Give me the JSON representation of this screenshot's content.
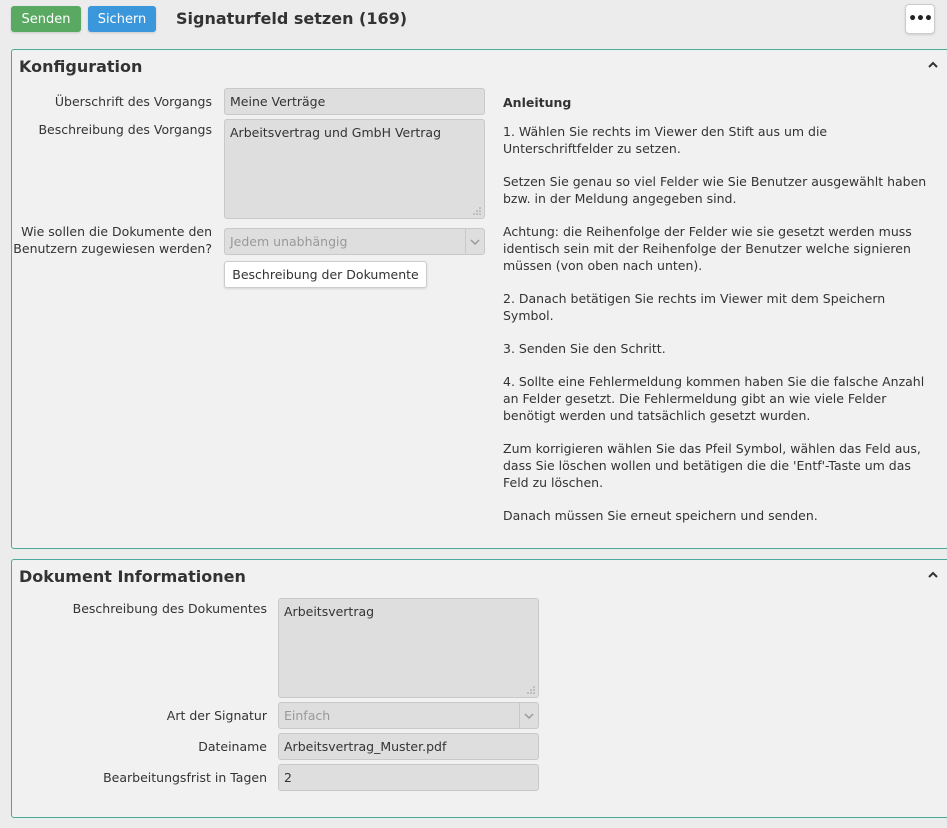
{
  "toolbar": {
    "send_label": "Senden",
    "save_label": "Sichern",
    "title": "Signaturfeld setzen (169)",
    "more_label": "•••"
  },
  "konfiguration": {
    "title": "Konfiguration",
    "ueberschrift_label": "Überschrift des Vorgangs",
    "ueberschrift_value": "Meine Verträge",
    "beschreibung_label": "Beschreibung des Vorgangs",
    "beschreibung_value": "Arbeitsvertrag und GmbH Vertrag",
    "zuweisung_label_1": "Wie sollen die Dokumente den",
    "zuweisung_label_2": "Benutzern zugewiesen werden?",
    "zuweisung_value": "Jedem unabhängig",
    "doc_button_label": "Beschreibung der Dokumente",
    "anleitung": {
      "title": "Anleitung",
      "paragraphs": [
        "1. Wählen Sie rechts im Viewer den Stift aus um die Unterschriftfelder zu setzen.",
        "Setzen Sie genau so viel Felder wie Sie Benutzer ausgewählt haben bzw. in der Meldung angegeben sind.",
        "Achtung: die Reihenfolge der Felder wie sie gesetzt werden muss identisch sein mit der Reihenfolge der Benutzer welche signieren müssen (von oben nach unten).",
        "2. Danach betätigen Sie rechts im Viewer mit dem Speichern Symbol.",
        "3. Senden Sie den Schritt.",
        "4. Sollte eine Fehlermeldung kommen haben Sie die falsche Anzahl an Felder gesetzt. Die Fehlermeldung gibt an wie viele Felder benötigt werden und tatsächlich gesetzt wurden.",
        "Zum korrigieren wählen Sie das Pfeil Symbol, wählen das Feld aus, dass Sie löschen wollen und betätigen die die 'Entf'-Taste um das Feld zu löschen.",
        "Danach müssen Sie erneut speichern und senden."
      ]
    }
  },
  "dokument": {
    "title": "Dokument Informationen",
    "beschreibung_label": "Beschreibung des Dokumentes",
    "beschreibung_value": "Arbeitsvertrag",
    "signatur_label": "Art der Signatur",
    "signatur_value": "Einfach",
    "dateiname_label": "Dateiname",
    "dateiname_value": "Arbeitsvertrag_Muster.pdf",
    "frist_label": "Bearbeitungsfrist in Tagen",
    "frist_value": "2"
  },
  "icons": {
    "collapse": "chevron-up-icon",
    "dropdown": "chevron-down-icon",
    "resize": "resize-grip-icon",
    "more": "more-dots-icon"
  },
  "colors": {
    "send": "#5aa963",
    "save": "#3b97dc",
    "panel_border": "#4aa89c"
  }
}
